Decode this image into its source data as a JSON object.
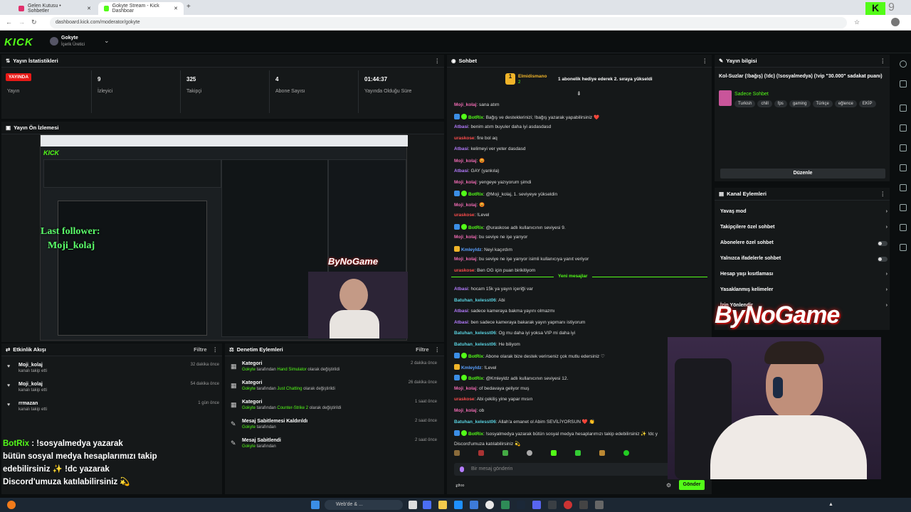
{
  "browser": {
    "tabs": [
      {
        "label": "Gelen Kutusu • Sohbetler"
      },
      {
        "label": "Gokyte Stream - Kick Dashboar"
      }
    ],
    "url": "dashboard.kick.com/moderator/gokyte"
  },
  "header": {
    "logo": "KICK",
    "channel": "Gokyte",
    "role": "İçerik Üretici"
  },
  "stats": {
    "title": "Yayın İstatistikleri",
    "live_badge": "YAYINDA",
    "live_label": "Yayın",
    "items": [
      {
        "value": "9",
        "label": "İzleyici"
      },
      {
        "value": "325",
        "label": "Takipçi"
      },
      {
        "value": "4",
        "label": "Abone Sayısı"
      },
      {
        "value": "01:44:37",
        "label": "Yayında Olduğu Süre"
      }
    ]
  },
  "preview": {
    "title": "Yayın Ön İzlemesi",
    "overlay_follower": "Last follower:",
    "overlay_name": "Moji_kolaj",
    "overlay_brand": "ByNoGame"
  },
  "activity": {
    "title": "Etkinlik Akışı",
    "filter": "Filtre",
    "items": [
      {
        "name": "Moji_kolaj",
        "desc": "kanalı takip etti",
        "time": "32 dakika önce"
      },
      {
        "name": "Moji_kolaj",
        "desc": "kanalı takip etti",
        "time": "54 dakika önce"
      },
      {
        "name": "rrmazan",
        "desc": "kanalı takip etti",
        "time": "1 gün önce"
      }
    ]
  },
  "moderation": {
    "title": "Denetim Eylemleri",
    "filter": "Filtre",
    "items": [
      {
        "title": "Kategori",
        "user": "Gokyte",
        "mid": "tarafından",
        "value": "Hand Simulator",
        "end": "olarak değiştirildi",
        "time": "2 dakika önce"
      },
      {
        "title": "Kategori",
        "user": "Gokyte",
        "mid": "tarafından",
        "value": "Just Chatting",
        "end": "olarak değiştirildi",
        "time": "26 dakika önce"
      },
      {
        "title": "Kategori",
        "user": "Gokyte",
        "mid": "tarafından",
        "value": "Counter-Strike 2",
        "end": "olarak değiştirildi",
        "time": "1 saat önce"
      },
      {
        "title": "Mesaj Sabitlemesi Kaldırıldı",
        "user": "Gokyte",
        "mid": "tarafından",
        "value": "",
        "end": "",
        "time": "2 saat önce"
      },
      {
        "title": "Mesaj Sabitlendi",
        "user": "Gokyte",
        "mid": "tarafından",
        "value": "",
        "end": "",
        "time": "2 saat önce"
      }
    ]
  },
  "bot_overlay": {
    "name": "BotRix",
    "lines": [
      ": !sosyalmedya yazarak",
      "bütün sosyal medya hesaplarımızı takip",
      "edebilirsiniz ✨ !dc yazarak",
      "Discord'umuza katılabilirsiniz 💫"
    ]
  },
  "chat": {
    "title": "Sohbet",
    "gift_user": "Elmidismano",
    "gift_count": "2",
    "gift_text": "1 abonelik hediye ederek 2. sıraya yükseldi",
    "new_messages": "Yeni mesajlar",
    "input_placeholder": "Bir mesaj gönderin",
    "send": "Gönder",
    "messages": [
      {
        "user": "Moji_kolaj",
        "color": "#f06bb3",
        "text": ": sana atım"
      },
      {
        "user": "BotRix",
        "color": "#53fc18",
        "text": ": Bağış ve desteklerinizi; !bağış yazarak yapabilirsiniz ❤️"
      },
      {
        "user": "Atbasi",
        "color": "#b57cff",
        "text": ": benim atım buyuler daha iyi asdasdasd"
      },
      {
        "user": "uraskose",
        "color": "#ff4d4d",
        "text": ": fire bol aq"
      },
      {
        "user": "Atbasi",
        "color": "#b57cff",
        "text": ": kelimeyi ver yeter dasdasd"
      },
      {
        "user": "Moji_kolaj",
        "color": "#f06bb3",
        "text": ": 😡"
      },
      {
        "user": "Atbasi",
        "color": "#b57cff",
        "text": ": GAY (yankıla)"
      },
      {
        "user": "Moji_kolaj",
        "color": "#f06bb3",
        "text": ": yengeye yazıyorum şimdi"
      },
      {
        "user": "BotRix",
        "color": "#53fc18",
        "text": ": @Moji_kolaj, 1. seviyeye yükseldin"
      },
      {
        "user": "Moji_kolaj",
        "color": "#f06bb3",
        "text": ": 😡"
      },
      {
        "user": "uraskose",
        "color": "#ff4d4d",
        "text": ": !Level"
      },
      {
        "user": "BotRix",
        "color": "#53fc18",
        "text": ": @uraskose adlı kullanıcının seviyesi 9."
      },
      {
        "user": "Moji_kolaj",
        "color": "#f06bb3",
        "text": ": bu seviye ne işe yarıyor"
      },
      {
        "user": "Kmleyldz",
        "color": "#5aa0ff",
        "text": ": Neyi kaçırdım"
      },
      {
        "user": "Moji_kolaj",
        "color": "#f06bb3",
        "text": ": bu seviye ne işe yarıyor isimli kullanıcıya yanıt veriyor"
      },
      {
        "user": "uraskose",
        "color": "#ff4d4d",
        "text": ": Ben OG için puan birikitiyom"
      }
    ],
    "messages2": [
      {
        "user": "Atbasi",
        "color": "#b57cff",
        "text": ": hocam 15k ya yayın içeriği var"
      },
      {
        "user": "Batuhan_kelesst06",
        "color": "#5ad2e0",
        "text": ": Abi"
      },
      {
        "user": "Atbasi",
        "color": "#b57cff",
        "text": ": sadece kameraya bakma yayını olmazmı"
      },
      {
        "user": "Atbasi",
        "color": "#b57cff",
        "text": ": ben sadece kameraya bakarak yayın yapmanı istiyorum"
      },
      {
        "user": "Batuhan_kelesst06",
        "color": "#5ad2e0",
        "text": ": Og mu daha iyi yoksa VIP mi daha iyi"
      },
      {
        "user": "Batuhan_kelesst06",
        "color": "#5ad2e0",
        "text": ": He biliyom"
      },
      {
        "user": "BotRix",
        "color": "#53fc18",
        "text": ": Abone olarak bize destek verirseniz çok mutlu edersiniz ♡"
      },
      {
        "user": "Kmleyldz",
        "color": "#5aa0ff",
        "text": ": !Level"
      },
      {
        "user": "BotRix",
        "color": "#53fc18",
        "text": ": @Kmleyldz adlı kullanıcının seviyesi 12."
      },
      {
        "user": "Moji_kolaj",
        "color": "#f06bb3",
        "text": ": of bedavaya geliyor muş"
      },
      {
        "user": "uraskose",
        "color": "#ff4d4d",
        "text": ": Abi çekiliş yine yapar mısın"
      },
      {
        "user": "Moji_kolaj",
        "color": "#f06bb3",
        "text": ": ob"
      },
      {
        "user": "Batuhan_kelesst06",
        "color": "#5ad2e0",
        "text": ": Allah'a emanet ol Abim SEVİLİYORSUN ❤️ 👏"
      },
      {
        "user": "BotRix",
        "color": "#53fc18",
        "text": ": !sosyalmedya yazarak bütün sosyal medya hesaplarımızı takip edebilirsiniz ✨ !dc y"
      },
      {
        "user": "",
        "color": "#ddd",
        "text": "Discord'umuza katılabilirsiniz 💫"
      }
    ]
  },
  "stream_info": {
    "title": "Yayın bilgisi",
    "stream_title": "Kol-Suzlar (!bağış) (!dc) (!sosyalmedya) (!vip \"30.000\" sadakat puanı)",
    "category": "Sadece Sohbet",
    "tags": [
      "Turkish",
      "chill",
      "fps",
      "gaming",
      "Türkçe",
      "eğlence",
      "EKİP"
    ],
    "edit": "Düzenle"
  },
  "channel_actions": {
    "title": "Kanal Eylemleri",
    "items": [
      {
        "label": "Yavaş mod",
        "kind": "chevron"
      },
      {
        "label": "Takipçilere özel sohbet",
        "kind": "chevron"
      },
      {
        "label": "Abonelere özel sohbet",
        "kind": "toggle"
      },
      {
        "label": "Yalnızca ifadelerle sohbet",
        "kind": "toggle"
      },
      {
        "label": "Hesap yaşı kısıtlaması",
        "kind": "chevron"
      },
      {
        "label": "Yasaklanmış kelimeler",
        "kind": "chevron"
      },
      {
        "label": "İzin Yönlendir",
        "kind": "chevron"
      }
    ]
  },
  "brand_overlay": "ByNoGame",
  "taskbar": {
    "search": "Web'de & ..."
  },
  "colors": {
    "kick_green": "#53fc18",
    "panel": "#151819",
    "live": "#e91916"
  }
}
